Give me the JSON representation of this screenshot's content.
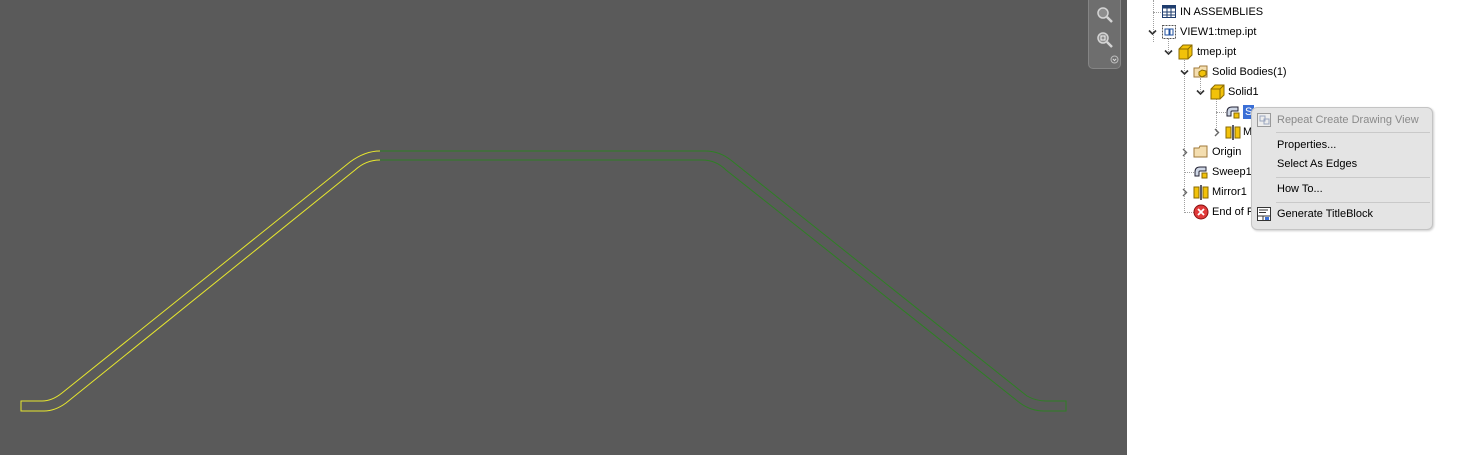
{
  "viewport": {
    "background": "#5a5a5a",
    "profile_colors": {
      "selected_left": "#e6e62e",
      "unselected_right": "#2e7f24"
    }
  },
  "nav_bar": {
    "buttons": [
      {
        "name": "zoom-icon",
        "icon": "magnifier"
      },
      {
        "name": "zoom-window-icon",
        "icon": "magnifier-box"
      }
    ],
    "caret": "chevron-down-icon"
  },
  "browser": {
    "items": [
      {
        "label": "IN ASSEMBLIES",
        "icon": "table-grid-icon"
      },
      {
        "label": "VIEW1:tmep.ipt",
        "icon": "drawing-view-icon"
      },
      {
        "label": "tmep.ipt",
        "icon": "part-icon"
      },
      {
        "label": "Solid Bodies(1)",
        "icon": "solid-bodies-folder-icon"
      },
      {
        "label": "Solid1",
        "icon": "solid-body-icon"
      },
      {
        "label": "S",
        "icon": "sweep-icon",
        "selected": true
      },
      {
        "label": "M",
        "icon": "mirror-icon"
      },
      {
        "label": "Origin",
        "icon": "folder-icon"
      },
      {
        "label": "Sweep1",
        "icon": "sweep-icon"
      },
      {
        "label": "Mirror1",
        "icon": "mirror-icon"
      },
      {
        "label": "End of P",
        "icon": "end-of-part-icon"
      }
    ]
  },
  "context_menu": {
    "items": [
      {
        "label": "Repeat Create Drawing View",
        "icon": "drawing-view-icon",
        "disabled": true
      },
      {
        "label": "Properties..."
      },
      {
        "label": "Select As Edges"
      },
      {
        "label": "How To..."
      },
      {
        "label": "Generate TitleBlock",
        "icon": "titleblock-icon"
      }
    ]
  }
}
